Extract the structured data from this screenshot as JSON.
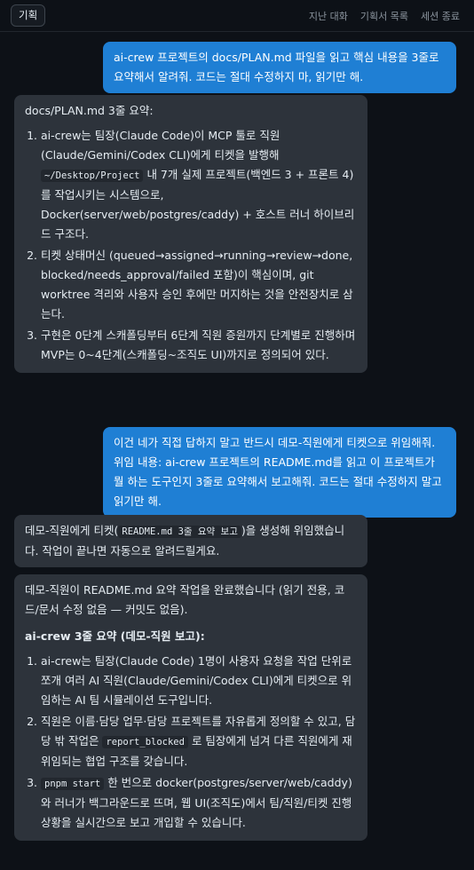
{
  "header": {
    "plan_button": "기획",
    "nav": [
      "지난 대화",
      "기획서 목록",
      "세션 종료"
    ]
  },
  "messages": {
    "m1": "ai-crew 프로젝트의 docs/PLAN.md 파일을 읽고 핵심 내용을 3줄로 요약해서 알려줘. 코드는 절대 수정하지 마, 읽기만 해.",
    "m2": {
      "title": "docs/PLAN.md 3줄 요약:",
      "items": [
        {
          "pre": "ai-crew는 팀장(Claude Code)이 MCP 툴로 직원(Claude/Gemini/Codex CLI)에게 티켓을 발행해",
          "code": "~/Desktop/Project",
          "post": "내 7개 실제 프로젝트(백엔드 3 + 프론트 4)를 작업시키는 시스템으로, Docker(server/web/postgres/caddy) + 호스트 러너 하이브리드 구조다."
        },
        {
          "pre": "티켓 상태머신 (queued→assigned→running→review→done, blocked/needs_approval/failed 포함)이 핵심이며, git worktree 격리와 사용자 승인 후에만 머지하는 것을 안전장치로 삼는다.",
          "code": "",
          "post": ""
        },
        {
          "pre": "구현은 0단계 스캐폴딩부터 6단계 직원 증원까지 단계별로 진행하며 MVP는 0~4단계(스캐폴딩~조직도 UI)까지로 정의되어 있다.",
          "code": "",
          "post": ""
        }
      ]
    },
    "m3": "이건 네가 직접 답하지 말고 반드시 데모-직원에게 티켓으로 위임해줘. 위임 내용: ai-crew 프로젝트의 README.md를 읽고 이 프로젝트가 뭘 하는 도구인지 3줄로 요약해서 보고해줘. 코드는 절대 수정하지 말고 읽기만 해.",
    "m4": {
      "pre": "데모-직원에게 티켓(",
      "code": "README.md 3줄 요약 보고",
      "post": ")을 생성해 위임했습니다. 작업이 끝나면 자동으로 알려드릴게요."
    },
    "m5": {
      "intro": "데모-직원이 README.md 요약 작업을 완료했습니다 (읽기 전용, 코드/문서 수정 없음 — 커밋도 없음).",
      "title": "ai-crew 3줄 요약 (데모-직원 보고):",
      "items": [
        {
          "pre": "",
          "code": "",
          "post": "ai-crew는 팀장(Claude Code) 1명이 사용자 요청을 작업 단위로 쪼개 여러 AI 직원(Claude/Gemini/Codex CLI)에게 티켓으로 위임하는 AI 팀 시뮬레이션 도구입니다."
        },
        {
          "pre": "직원은 이름·담당 업무·담당 프로젝트를 자유롭게 정의할 수 있고, 담당 밖 작업은",
          "code": "report_blocked",
          "post": "로 팀장에게 넘겨 다른 직원에게 재위임되는 협업 구조를 갖습니다."
        },
        {
          "pre": "",
          "code": "pnpm start",
          "post": "한 번으로 docker(postgres/server/web/caddy)와 러너가 백그라운드로 뜨며, 웹 UI(조직도)에서 팀/직원/티켓 진행 상황을 실시간으로 보고 개입할 수 있습니다."
        }
      ]
    }
  }
}
